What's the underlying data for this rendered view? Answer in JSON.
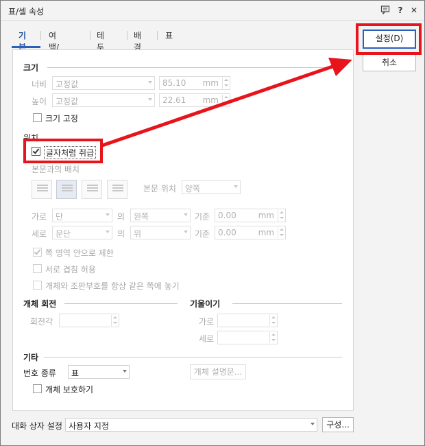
{
  "window": {
    "title": "표/셀 속성"
  },
  "tabs": [
    {
      "label": "기본"
    },
    {
      "label": "여백/캡션"
    },
    {
      "label": "테두리"
    },
    {
      "label": "배경"
    },
    {
      "label": "표"
    }
  ],
  "size": {
    "header": "크기",
    "width_label": "너비",
    "width_mode": "고정값",
    "width_value": "85.10",
    "width_unit": "mm",
    "height_label": "높이",
    "height_mode": "고정값",
    "height_value": "22.61",
    "height_unit": "mm",
    "fix_size_label": "크기 고정"
  },
  "position": {
    "header": "위치",
    "treat_as_char_label": "글자처럼 취급",
    "treat_as_char_checked": true,
    "wrap_label": "본문과의 배치",
    "text_pos_label": "본문 위치",
    "text_pos_value": "양쪽",
    "horiz_label": "가로",
    "horiz_ref": "단",
    "horiz_of": "의",
    "horiz_align": "왼쪽",
    "horiz_base_label": "기준",
    "horiz_value": "0.00",
    "horiz_unit": "mm",
    "vert_label": "세로",
    "vert_ref": "문단",
    "vert_of": "의",
    "vert_align": "위",
    "vert_base_label": "기준",
    "vert_value": "0.00",
    "vert_unit": "mm",
    "limit_page_label": "쪽 영역 안으로 제한",
    "overlap_label": "서로 겹침 허용",
    "same_page_label": "개체와 조판부호를 항상 같은 쪽에 놓기"
  },
  "rotation": {
    "header": "개체 회전",
    "angle_label": "회전각"
  },
  "skew": {
    "header": "기울이기",
    "h_label": "가로",
    "v_label": "세로"
  },
  "etc": {
    "header": "기타",
    "number_type_label": "번호 종류",
    "number_type_value": "표",
    "desc_button": "개체 설명문...",
    "protect_label": "개체 보호하기"
  },
  "buttons": {
    "ok": "설정(D)",
    "cancel": "취소"
  },
  "footer": {
    "label": "대화 상자 설정",
    "value": "사용자 지정",
    "config_button": "구성..."
  },
  "colors": {
    "highlight": "#e8141b",
    "accent": "#2b5fb8"
  }
}
